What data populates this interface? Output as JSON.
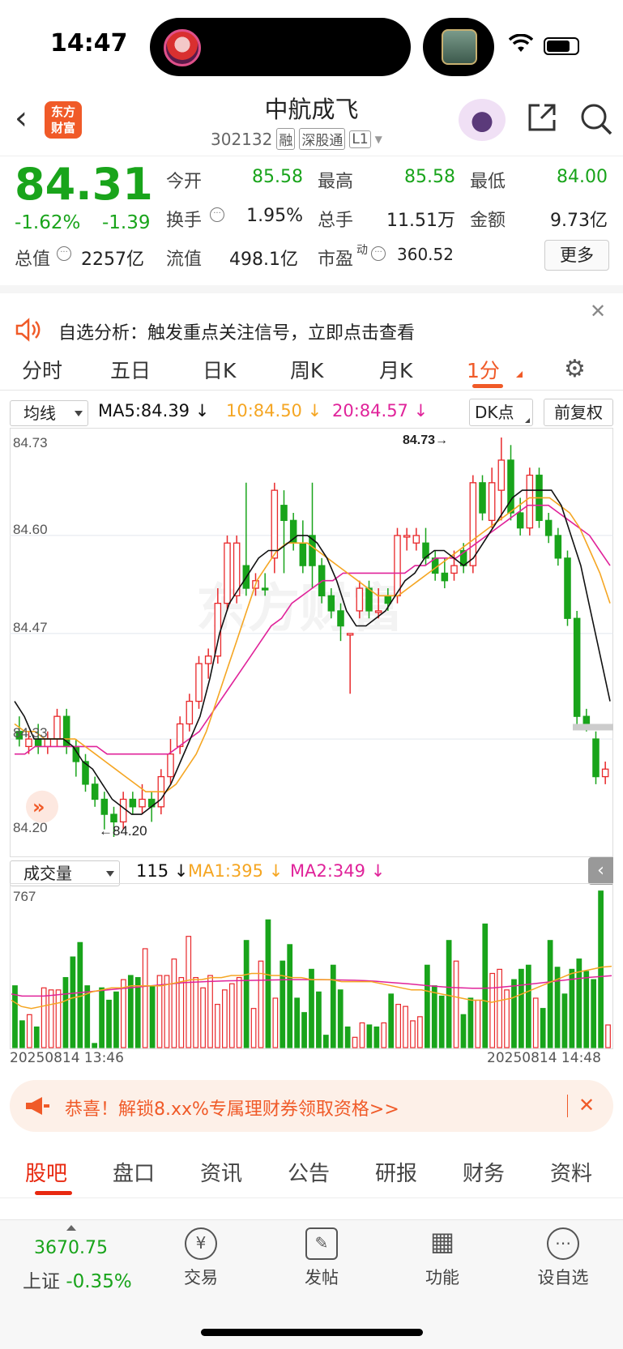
{
  "status": {
    "time": "14:47"
  },
  "header": {
    "stock_name": "中航成飞",
    "stock_code": "302132",
    "tags": [
      "融",
      "深股通",
      "L1"
    ],
    "logo_text": "东方\n财富"
  },
  "quote": {
    "price": "84.31",
    "change_pct": "-1.62%",
    "change": "-1.39",
    "rows": [
      [
        {
          "label": "今开",
          "value": "85.58",
          "color": "green"
        },
        {
          "label": "最高",
          "value": "85.58",
          "color": "green"
        },
        {
          "label": "最低",
          "value": "84.00",
          "color": "green"
        }
      ],
      [
        {
          "label": "换手",
          "value": "1.95%",
          "color": "dark"
        },
        {
          "label": "总手",
          "value": "11.51万",
          "color": "dark"
        },
        {
          "label": "金额",
          "value": "9.73亿",
          "color": "dark"
        }
      ]
    ],
    "row3": [
      {
        "label": "总值",
        "value": "2257亿"
      },
      {
        "label": "流值",
        "value": "498.1亿"
      },
      {
        "label": "市盈",
        "sup": "动",
        "value": "360.52"
      }
    ],
    "more": "更多"
  },
  "notice": {
    "text": "自选分析：触发重点关注信号，立即点击查看"
  },
  "tabs": [
    "分时",
    "五日",
    "日K",
    "周K",
    "月K",
    "1分"
  ],
  "active_tab": "1分",
  "chart_toolbar": {
    "indicator": "均线",
    "ma5": "MA5:84.39",
    "ma10": "10:84.50",
    "ma20": "20:84.57",
    "dk": "DK点",
    "adjust": "前复权"
  },
  "volume_toolbar": {
    "indicator": "成交量",
    "vol": "115",
    "ma1": "MA1:395",
    "ma2": "MA2:349"
  },
  "colors": {
    "up": "#e8282b",
    "down": "#19a41b",
    "ma5": "#111111",
    "ma10": "#f5a623",
    "ma20": "#e0239a",
    "accent": "#f05a28"
  },
  "chart_data": {
    "type": "candlestick",
    "ylim": [
      84.2,
      84.73
    ],
    "y_ticks": [
      "84.73",
      "84.60",
      "84.47",
      "84.33",
      "84.20"
    ],
    "max_label": "84.73",
    "min_label": "84.20",
    "x_start": "20250814 13:46",
    "x_end": "20250814 14:48",
    "vol_max_label": "767",
    "candles": [
      [
        84.34,
        84.33,
        84.36,
        84.32,
        "d"
      ],
      [
        84.32,
        84.33,
        84.34,
        84.31,
        "u"
      ],
      [
        84.33,
        84.32,
        84.35,
        84.31,
        "d"
      ],
      [
        84.32,
        84.33,
        84.34,
        84.31,
        "u"
      ],
      [
        84.33,
        84.36,
        84.37,
        84.32,
        "u"
      ],
      [
        84.36,
        84.32,
        84.37,
        84.31,
        "d"
      ],
      [
        84.32,
        84.3,
        84.33,
        84.28,
        "d"
      ],
      [
        84.3,
        84.27,
        84.31,
        84.26,
        "d"
      ],
      [
        84.27,
        84.25,
        84.28,
        84.24,
        "d"
      ],
      [
        84.25,
        84.23,
        84.26,
        84.21,
        "d"
      ],
      [
        84.23,
        84.22,
        84.24,
        84.2,
        "d"
      ],
      [
        84.22,
        84.25,
        84.26,
        84.21,
        "u"
      ],
      [
        84.25,
        84.24,
        84.26,
        84.23,
        "d"
      ],
      [
        84.24,
        84.25,
        84.27,
        84.23,
        "u"
      ],
      [
        84.25,
        84.24,
        84.26,
        84.22,
        "d"
      ],
      [
        84.24,
        84.28,
        84.29,
        84.23,
        "u"
      ],
      [
        84.28,
        84.31,
        84.33,
        84.27,
        "u"
      ],
      [
        84.32,
        84.35,
        84.36,
        84.31,
        "u"
      ],
      [
        84.35,
        84.38,
        84.39,
        84.34,
        "u"
      ],
      [
        84.38,
        84.43,
        84.44,
        84.37,
        "u"
      ],
      [
        84.43,
        84.44,
        84.45,
        84.41,
        "u"
      ],
      [
        84.44,
        84.51,
        84.53,
        84.43,
        "u"
      ],
      [
        84.51,
        84.59,
        84.6,
        84.5,
        "u"
      ],
      [
        84.52,
        84.59,
        84.6,
        84.51,
        "u"
      ],
      [
        84.56,
        84.53,
        84.67,
        84.52,
        "d"
      ],
      [
        84.53,
        84.54,
        84.55,
        84.52,
        "u"
      ],
      [
        84.53,
        84.53,
        84.55,
        84.52,
        "d"
      ],
      [
        84.57,
        84.66,
        84.67,
        84.55,
        "u"
      ],
      [
        84.64,
        84.62,
        84.66,
        84.55,
        "d"
      ],
      [
        84.62,
        84.59,
        84.63,
        84.58,
        "d"
      ],
      [
        84.59,
        84.56,
        84.62,
        84.55,
        "d"
      ],
      [
        84.6,
        84.56,
        84.67,
        84.53,
        "d"
      ],
      [
        84.56,
        84.52,
        84.57,
        84.51,
        "d"
      ],
      [
        84.52,
        84.5,
        84.53,
        84.49,
        "d"
      ],
      [
        84.5,
        84.48,
        84.51,
        84.46,
        "d"
      ],
      [
        84.47,
        84.47,
        84.47,
        84.39,
        "u"
      ],
      [
        84.5,
        84.53,
        84.54,
        84.49,
        "u"
      ],
      [
        84.53,
        84.5,
        84.54,
        84.49,
        "d"
      ],
      [
        84.5,
        84.5,
        84.53,
        84.49,
        "u"
      ],
      [
        84.52,
        84.51,
        84.53,
        84.5,
        "d"
      ],
      [
        84.52,
        84.6,
        84.61,
        84.51,
        "u"
      ],
      [
        84.6,
        84.6,
        84.61,
        84.58,
        "u"
      ],
      [
        84.59,
        84.6,
        84.61,
        84.58,
        "u"
      ],
      [
        84.59,
        84.57,
        84.61,
        84.56,
        "d"
      ],
      [
        84.57,
        84.55,
        84.58,
        84.54,
        "d"
      ],
      [
        84.55,
        84.54,
        84.57,
        84.53,
        "d"
      ],
      [
        84.55,
        84.56,
        84.58,
        84.54,
        "u"
      ],
      [
        84.58,
        84.56,
        84.59,
        84.55,
        "d"
      ],
      [
        84.56,
        84.67,
        84.68,
        84.55,
        "u"
      ],
      [
        84.67,
        84.63,
        84.68,
        84.62,
        "d"
      ],
      [
        84.62,
        84.67,
        84.69,
        84.61,
        "u"
      ],
      [
        84.66,
        84.7,
        84.73,
        84.62,
        "u"
      ],
      [
        84.7,
        84.63,
        84.72,
        84.62,
        "d"
      ],
      [
        84.63,
        84.61,
        84.65,
        84.6,
        "d"
      ],
      [
        84.61,
        84.68,
        84.69,
        84.6,
        "u"
      ],
      [
        84.68,
        84.62,
        84.69,
        84.61,
        "d"
      ],
      [
        84.62,
        84.6,
        84.63,
        84.59,
        "d"
      ],
      [
        84.6,
        84.57,
        84.61,
        84.56,
        "d"
      ],
      [
        84.57,
        84.49,
        84.58,
        84.48,
        "d"
      ],
      [
        84.49,
        84.36,
        84.5,
        84.35,
        "d"
      ],
      [
        84.36,
        84.35,
        84.37,
        84.34,
        "d"
      ],
      [
        84.33,
        84.28,
        84.34,
        84.27,
        "d"
      ],
      [
        84.28,
        84.29,
        84.3,
        84.27,
        "u"
      ]
    ],
    "ma5": [
      84.38,
      84.36,
      84.33,
      84.33,
      84.33,
      84.33,
      84.32,
      84.3,
      84.29,
      84.27,
      84.25,
      84.24,
      84.23,
      84.23,
      84.24,
      84.25,
      84.27,
      84.3,
      84.33,
      84.36,
      84.41,
      84.47,
      84.51,
      84.53,
      84.55,
      84.57,
      84.58,
      84.58,
      84.59,
      84.6,
      84.6,
      84.59,
      84.57,
      84.54,
      84.5,
      84.48,
      84.48,
      84.49,
      84.5,
      84.52,
      84.54,
      84.55,
      84.57,
      84.58,
      84.58,
      84.57,
      84.56,
      84.57,
      84.59,
      84.61,
      84.63,
      84.65,
      84.66,
      84.66,
      84.66,
      84.66,
      84.64,
      84.6,
      84.56,
      84.5,
      84.44,
      84.38
    ],
    "ma10": [
      84.35,
      84.34,
      84.34,
      84.33,
      84.33,
      84.33,
      84.33,
      84.32,
      84.31,
      84.3,
      84.29,
      84.28,
      84.27,
      84.26,
      84.26,
      84.26,
      84.27,
      84.29,
      84.31,
      84.34,
      84.38,
      84.42,
      84.46,
      84.5,
      84.54,
      84.56,
      84.58,
      84.59,
      84.59,
      84.59,
      84.58,
      84.57,
      84.56,
      84.55,
      84.54,
      84.53,
      84.52,
      84.52,
      84.52,
      84.53,
      84.54,
      84.55,
      84.56,
      84.57,
      84.58,
      84.59,
      84.6,
      84.61,
      84.62,
      84.63,
      84.64,
      84.65,
      84.65,
      84.65,
      84.64,
      84.63,
      84.61,
      84.58,
      84.55,
      84.51
    ],
    "ma20": [
      84.31,
      84.31,
      84.32,
      84.32,
      84.32,
      84.32,
      84.32,
      84.32,
      84.32,
      84.31,
      84.31,
      84.31,
      84.31,
      84.31,
      84.31,
      84.31,
      84.32,
      84.33,
      84.34,
      84.36,
      84.38,
      84.4,
      84.42,
      84.44,
      84.46,
      84.48,
      84.49,
      84.51,
      84.52,
      84.53,
      84.54,
      84.54,
      84.55,
      84.55,
      84.55,
      84.55,
      84.55,
      84.55,
      84.55,
      84.56,
      84.56,
      84.57,
      84.57,
      84.57,
      84.58,
      84.59,
      84.6,
      84.61,
      84.62,
      84.63,
      84.64,
      84.64,
      84.64,
      84.63,
      84.62,
      84.61,
      84.6,
      84.58,
      84.56
    ],
    "volumes": [
      300,
      130,
      160,
      100,
      290,
      280,
      280,
      340,
      440,
      510,
      300,
      20,
      290,
      230,
      270,
      330,
      350,
      340,
      480,
      300,
      350,
      350,
      430,
      340,
      540,
      340,
      290,
      350,
      210,
      280,
      310,
      340,
      520,
      190,
      420,
      620,
      240,
      420,
      500,
      240,
      170,
      380,
      270,
      60,
      400,
      280,
      100,
      50,
      120,
      110,
      100,
      120,
      260,
      210,
      200,
      130,
      150,
      400,
      300,
      250,
      520,
      420,
      160,
      240,
      230,
      600,
      360,
      380,
      280,
      330,
      380,
      400,
      240,
      190,
      520,
      390,
      260,
      380,
      430,
      370,
      330,
      760,
      110
    ],
    "vol_ma1": [
      230,
      200,
      190,
      200,
      210,
      220,
      240,
      250,
      270,
      280,
      290,
      290,
      300,
      300,
      300,
      300,
      310,
      320,
      330,
      330,
      340,
      340,
      350,
      350,
      360,
      360,
      350,
      350,
      340,
      340,
      330,
      330,
      330,
      320,
      320,
      320,
      320,
      310,
      300,
      290,
      280,
      280,
      270,
      260,
      250,
      240,
      230,
      230,
      220,
      230,
      240,
      260,
      280,
      300,
      320,
      340,
      360,
      370,
      380,
      390,
      395
    ],
    "vol_ma2": [
      260,
      250,
      250,
      250,
      255,
      260,
      265,
      270,
      275,
      280,
      285,
      290,
      295,
      300,
      305,
      310,
      315,
      318,
      320,
      322,
      324,
      325,
      326,
      327,
      328,
      329,
      330,
      330,
      330,
      330,
      329,
      328,
      327,
      325,
      322,
      318,
      314,
      310,
      305,
      300,
      296,
      292,
      290,
      288,
      288,
      290,
      295,
      300,
      306,
      312,
      318,
      324,
      330,
      336,
      341,
      345,
      349
    ]
  },
  "promo": {
    "text": "恭喜！解锁8.xx%专属理财券领取资格>>"
  },
  "bottom_tabs": [
    "股吧",
    "盘口",
    "资讯",
    "公告",
    "研报",
    "财务",
    "资料"
  ],
  "nav": {
    "index_value": "3670.75",
    "index_name": "上证",
    "index_change": "-0.35%",
    "items": [
      {
        "label": "交易",
        "glyph": "¥"
      },
      {
        "label": "发帖",
        "glyph": "✎"
      },
      {
        "label": "功能",
        "glyph": "▦"
      },
      {
        "label": "设自选",
        "glyph": "⋯"
      }
    ]
  }
}
